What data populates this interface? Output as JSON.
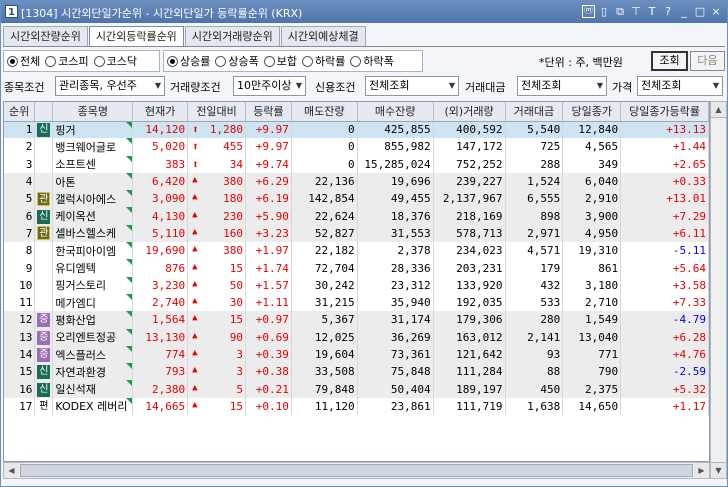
{
  "window": {
    "badge": "1",
    "title": "[1304] 시간외단일가순위 - 시간외단일가 등락률순위 (KRX)",
    "controls": [
      "ⓜ",
      "▯",
      "⧉",
      "⊤",
      "T",
      "?",
      "_",
      "□",
      "×"
    ]
  },
  "tabs": [
    "시간외잔량순위",
    "시간외등락률순위",
    "시간외거래량순위",
    "시간외예상체결"
  ],
  "active_tab": 1,
  "market_radios": [
    {
      "label": "전체",
      "checked": true
    },
    {
      "label": "코스피",
      "checked": false
    },
    {
      "label": "코스닥",
      "checked": false
    }
  ],
  "rank_radios": [
    {
      "label": "상승률",
      "checked": true
    },
    {
      "label": "상승폭",
      "checked": false
    },
    {
      "label": "보합",
      "checked": false
    },
    {
      "label": "하락률",
      "checked": false
    },
    {
      "label": "하락폭",
      "checked": false
    }
  ],
  "unit_text": "*단위 : 주, 백만원",
  "query_button": "조회",
  "next_button": "다음",
  "filters": {
    "stock_cond_label": "종목조건",
    "stock_cond_value": "관리종목, 우선주",
    "volume_cond_label": "거래량조건",
    "volume_cond_value": "10만주이상",
    "credit_cond_label": "신용조건",
    "credit_cond_value": "전체조회",
    "amount_label": "거래대금",
    "amount_value": "전체조회",
    "price_label": "가격",
    "price_value": "전체조회"
  },
  "columns": [
    "순위",
    "",
    "종목명",
    "현재가",
    "전일대비",
    "등락률",
    "매도잔량",
    "매수잔량",
    "(외)거래량",
    "거래대금",
    "당일종가",
    "당일종가등락률"
  ],
  "rows": [
    {
      "rank": "1",
      "tag": "신",
      "tagtype": "sin",
      "name": "핑거",
      "price": "14,120",
      "dir": "limit",
      "change": "1,280",
      "rate": "+9.97",
      "sell": "0",
      "buy": "425,855",
      "vol": "400,592",
      "amount": "5,540",
      "close": "12,840",
      "close_rate": "+13.13",
      "close_dir": "up"
    },
    {
      "rank": "2",
      "tag": "",
      "tagtype": "",
      "name": "뱅크웨어글로",
      "price": "5,020",
      "dir": "limit",
      "change": "455",
      "rate": "+9.97",
      "sell": "0",
      "buy": "855,982",
      "vol": "147,172",
      "amount": "725",
      "close": "4,565",
      "close_rate": "+1.44",
      "close_dir": "up"
    },
    {
      "rank": "3",
      "tag": "",
      "tagtype": "",
      "name": "소프트센",
      "price": "383",
      "dir": "limit",
      "change": "34",
      "rate": "+9.74",
      "sell": "0",
      "buy": "15,285,024",
      "vol": "752,252",
      "amount": "288",
      "close": "349",
      "close_rate": "+2.65",
      "close_dir": "up"
    },
    {
      "rank": "4",
      "tag": "",
      "tagtype": "",
      "name": "아톤",
      "price": "6,420",
      "dir": "up",
      "change": "380",
      "rate": "+6.29",
      "sell": "22,136",
      "buy": "19,696",
      "vol": "239,227",
      "amount": "1,524",
      "close": "6,040",
      "close_rate": "+0.33",
      "close_dir": "up"
    },
    {
      "rank": "5",
      "tag": "관",
      "tagtype": "gwan",
      "name": "갤럭시아에스",
      "price": "3,090",
      "dir": "up",
      "change": "180",
      "rate": "+6.19",
      "sell": "142,854",
      "buy": "49,455",
      "vol": "2,137,967",
      "amount": "6,555",
      "close": "2,910",
      "close_rate": "+13.01",
      "close_dir": "up"
    },
    {
      "rank": "6",
      "tag": "신",
      "tagtype": "sin",
      "name": "케이옥션",
      "price": "4,130",
      "dir": "up",
      "change": "230",
      "rate": "+5.90",
      "sell": "22,624",
      "buy": "18,376",
      "vol": "218,169",
      "amount": "898",
      "close": "3,900",
      "close_rate": "+7.29",
      "close_dir": "up"
    },
    {
      "rank": "7",
      "tag": "관",
      "tagtype": "gwan",
      "name": "셀바스헬스케",
      "price": "5,110",
      "dir": "up",
      "change": "160",
      "rate": "+3.23",
      "sell": "52,827",
      "buy": "31,553",
      "vol": "578,713",
      "amount": "2,971",
      "close": "4,950",
      "close_rate": "+6.11",
      "close_dir": "up"
    },
    {
      "rank": "8",
      "tag": "",
      "tagtype": "",
      "name": "한국피아이엠",
      "price": "19,690",
      "dir": "up",
      "change": "380",
      "rate": "+1.97",
      "sell": "22,182",
      "buy": "2,378",
      "vol": "234,023",
      "amount": "4,571",
      "close": "19,310",
      "close_rate": "-5.11",
      "close_dir": "dn"
    },
    {
      "rank": "9",
      "tag": "",
      "tagtype": "",
      "name": "유디엠텍",
      "price": "876",
      "dir": "up",
      "change": "15",
      "rate": "+1.74",
      "sell": "72,704",
      "buy": "28,336",
      "vol": "203,231",
      "amount": "179",
      "close": "861",
      "close_rate": "+5.64",
      "close_dir": "up"
    },
    {
      "rank": "10",
      "tag": "",
      "tagtype": "",
      "name": "핑거스토리",
      "price": "3,230",
      "dir": "up",
      "change": "50",
      "rate": "+1.57",
      "sell": "30,242",
      "buy": "23,312",
      "vol": "133,920",
      "amount": "432",
      "close": "3,180",
      "close_rate": "+3.58",
      "close_dir": "up"
    },
    {
      "rank": "11",
      "tag": "",
      "tagtype": "",
      "name": "메가엠디",
      "price": "2,740",
      "dir": "up",
      "change": "30",
      "rate": "+1.11",
      "sell": "31,215",
      "buy": "35,940",
      "vol": "192,035",
      "amount": "533",
      "close": "2,710",
      "close_rate": "+7.33",
      "close_dir": "up"
    },
    {
      "rank": "12",
      "tag": "증",
      "tagtype": "jeung",
      "name": "평화산업",
      "price": "1,564",
      "dir": "up",
      "change": "15",
      "rate": "+0.97",
      "sell": "5,367",
      "buy": "31,174",
      "vol": "179,306",
      "amount": "280",
      "close": "1,549",
      "close_rate": "-4.79",
      "close_dir": "dn"
    },
    {
      "rank": "13",
      "tag": "증",
      "tagtype": "jeung",
      "name": "오리엔트정공",
      "price": "13,130",
      "dir": "up",
      "change": "90",
      "rate": "+0.69",
      "sell": "12,025",
      "buy": "36,269",
      "vol": "163,012",
      "amount": "2,141",
      "close": "13,040",
      "close_rate": "+6.28",
      "close_dir": "up"
    },
    {
      "rank": "14",
      "tag": "증",
      "tagtype": "jeung",
      "name": "엑스플러스",
      "price": "774",
      "dir": "up",
      "change": "3",
      "rate": "+0.39",
      "sell": "19,604",
      "buy": "73,361",
      "vol": "121,642",
      "amount": "93",
      "close": "771",
      "close_rate": "+4.76",
      "close_dir": "up"
    },
    {
      "rank": "15",
      "tag": "신",
      "tagtype": "sin",
      "name": "자연과환경",
      "price": "793",
      "dir": "up",
      "change": "3",
      "rate": "+0.38",
      "sell": "33,508",
      "buy": "75,848",
      "vol": "111,284",
      "amount": "88",
      "close": "790",
      "close_rate": "-2.59",
      "close_dir": "dn"
    },
    {
      "rank": "16",
      "tag": "신",
      "tagtype": "sin",
      "name": "일신석재",
      "price": "2,380",
      "dir": "up",
      "change": "5",
      "rate": "+0.21",
      "sell": "79,848",
      "buy": "50,404",
      "vol": "189,197",
      "amount": "450",
      "close": "2,375",
      "close_rate": "+5.32",
      "close_dir": "up"
    },
    {
      "rank": "17",
      "tag": "편",
      "tagtype": "pyeon",
      "name": "KODEX 레버리",
      "price": "14,665",
      "dir": "up",
      "change": "15",
      "rate": "+0.10",
      "sell": "11,120",
      "buy": "23,861",
      "vol": "111,719",
      "amount": "1,638",
      "close": "14,650",
      "close_rate": "+1.17",
      "close_dir": "up"
    }
  ]
}
